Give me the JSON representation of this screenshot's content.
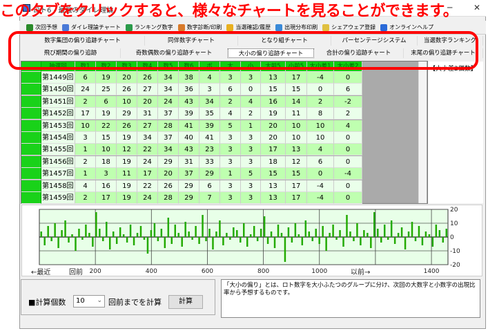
{
  "window": {
    "title": "ロト6 - 最強のダイレ理論",
    "overlay_note": "このタブをクリックすると、様々なチャートを見ることができます。"
  },
  "toolbar": [
    {
      "label": "次回予想",
      "color": "#2a8a2a"
    },
    {
      "label": "ダイレ理論チャート",
      "color": "#4a7ad8"
    },
    {
      "label": "ランキング数字",
      "color": "#2a9a4a"
    },
    {
      "label": "数字診断/印刷",
      "color": "#d87a2a"
    },
    {
      "label": "当選確認/履歴",
      "color": "#e8b020"
    },
    {
      "label": "出現分布印刷",
      "color": "#3a8ad8"
    },
    {
      "label": "シェアウェア登録",
      "color": "#e0c040"
    },
    {
      "label": "オンラインヘルプ",
      "color": "#2a6ad8"
    }
  ],
  "tabs_row1": [
    "数字集団の偏り追跡チャート",
    "同伴数字チャート",
    "となり組チャート",
    "パーセンテージシステム",
    "当選数字ランキング"
  ],
  "tabs_row2": [
    "飛び期間の偏り追跡",
    "奇数偶数の偏り追跡チャート",
    "大小の偏り追跡チャート",
    "合計の偏り追跡チャート",
    "末尾の偏り追跡チャート"
  ],
  "active_tab": "大小の偏り追跡チャート",
  "grid": {
    "columns": [
      "抽選回",
      "数1",
      "数2",
      "数3",
      "数4",
      "数5",
      "数6",
      "ボ",
      "大",
      "小",
      "大前5",
      "小前5",
      "大小差1",
      "大小差2"
    ],
    "rows": [
      [
        "第1449回",
        "6",
        "19",
        "20",
        "26",
        "34",
        "38",
        "4",
        "3",
        "3",
        "13",
        "17",
        "-4",
        "0"
      ],
      [
        "第1450回",
        "24",
        "25",
        "26",
        "27",
        "34",
        "36",
        "3",
        "6",
        "0",
        "15",
        "15",
        "0",
        "6"
      ],
      [
        "第1451回",
        "2",
        "6",
        "10",
        "20",
        "24",
        "43",
        "34",
        "2",
        "4",
        "16",
        "14",
        "2",
        "-2"
      ],
      [
        "第1452回",
        "17",
        "19",
        "29",
        "31",
        "37",
        "39",
        "35",
        "4",
        "2",
        "19",
        "11",
        "8",
        "2"
      ],
      [
        "第1453回",
        "10",
        "22",
        "26",
        "27",
        "28",
        "41",
        "39",
        "5",
        "1",
        "20",
        "10",
        "10",
        "4"
      ],
      [
        "第1454回",
        "3",
        "15",
        "19",
        "34",
        "37",
        "40",
        "41",
        "3",
        "3",
        "20",
        "10",
        "10",
        "0"
      ],
      [
        "第1455回",
        "1",
        "10",
        "12",
        "22",
        "34",
        "43",
        "23",
        "3",
        "3",
        "17",
        "13",
        "4",
        "0"
      ],
      [
        "第1456回",
        "2",
        "18",
        "19",
        "24",
        "29",
        "31",
        "33",
        "3",
        "3",
        "18",
        "12",
        "6",
        "0"
      ],
      [
        "第1457回",
        "1",
        "3",
        "11",
        "17",
        "20",
        "37",
        "29",
        "1",
        "5",
        "15",
        "15",
        "0",
        "-4"
      ],
      [
        "第1458回",
        "4",
        "16",
        "19",
        "22",
        "26",
        "29",
        "6",
        "3",
        "3",
        "13",
        "17",
        "-4",
        "0"
      ],
      [
        "第1459回",
        "2",
        "17",
        "19",
        "24",
        "28",
        "29",
        "7",
        "3",
        "3",
        "13",
        "17",
        "-4",
        "0"
      ]
    ]
  },
  "right_panel_label": "【大小差2個数】",
  "chart_data": {
    "type": "bar",
    "xlim": [
      0,
      1459
    ],
    "ylim": [
      -20,
      20
    ],
    "xticks": [
      "200",
      "400",
      "600",
      "800",
      "1000",
      "1400"
    ],
    "xtick_values": [
      200,
      400,
      600,
      800,
      1000,
      1400
    ],
    "yticks": [
      "20",
      "10",
      "0",
      "-10",
      "-20"
    ],
    "ytick_values": [
      20,
      10,
      0,
      -10,
      -20
    ],
    "left_label": "←最近",
    "left_label2": "回前",
    "right_label": "以前→",
    "grid": true,
    "color": "#22aa00",
    "values": [
      4,
      -6,
      8,
      -3,
      10,
      -8,
      5,
      12,
      -4,
      2,
      -10,
      6,
      -2,
      9,
      3,
      -7,
      18,
      6,
      -3,
      11,
      -9,
      4,
      -5,
      7,
      2,
      -4,
      9,
      -6,
      3,
      8,
      -2,
      -12,
      5,
      10,
      -3,
      6,
      -8,
      14,
      -5,
      9,
      3,
      -7,
      11,
      4,
      -2,
      8,
      -5,
      16,
      -3,
      6,
      -9,
      4,
      12,
      -6,
      3,
      -2,
      7,
      5,
      -4,
      10,
      -7,
      2,
      8,
      -3,
      6,
      15,
      -5,
      4,
      -8,
      9,
      3,
      -18,
      7,
      -4,
      10,
      2,
      -6,
      12,
      4,
      -3,
      6,
      -5,
      8,
      -10,
      3,
      9,
      -2,
      5,
      -7,
      16,
      4,
      -3,
      10,
      -6,
      5,
      3,
      -8,
      18,
      6,
      -4,
      9,
      -2,
      12,
      -5,
      3,
      7,
      -9,
      4,
      11,
      -3,
      8,
      -6,
      4,
      2,
      -7,
      9,
      5,
      -4,
      6
    ]
  },
  "calc": {
    "label": "■計算個数",
    "select_value": "10",
    "suffix": "回前までを計算",
    "button": "計算"
  },
  "description": "「大小の偏り」とは、ロト数字を大小ふたつのグループに分け、次回の大数字と小数字の出現比率から予想するものです。"
}
